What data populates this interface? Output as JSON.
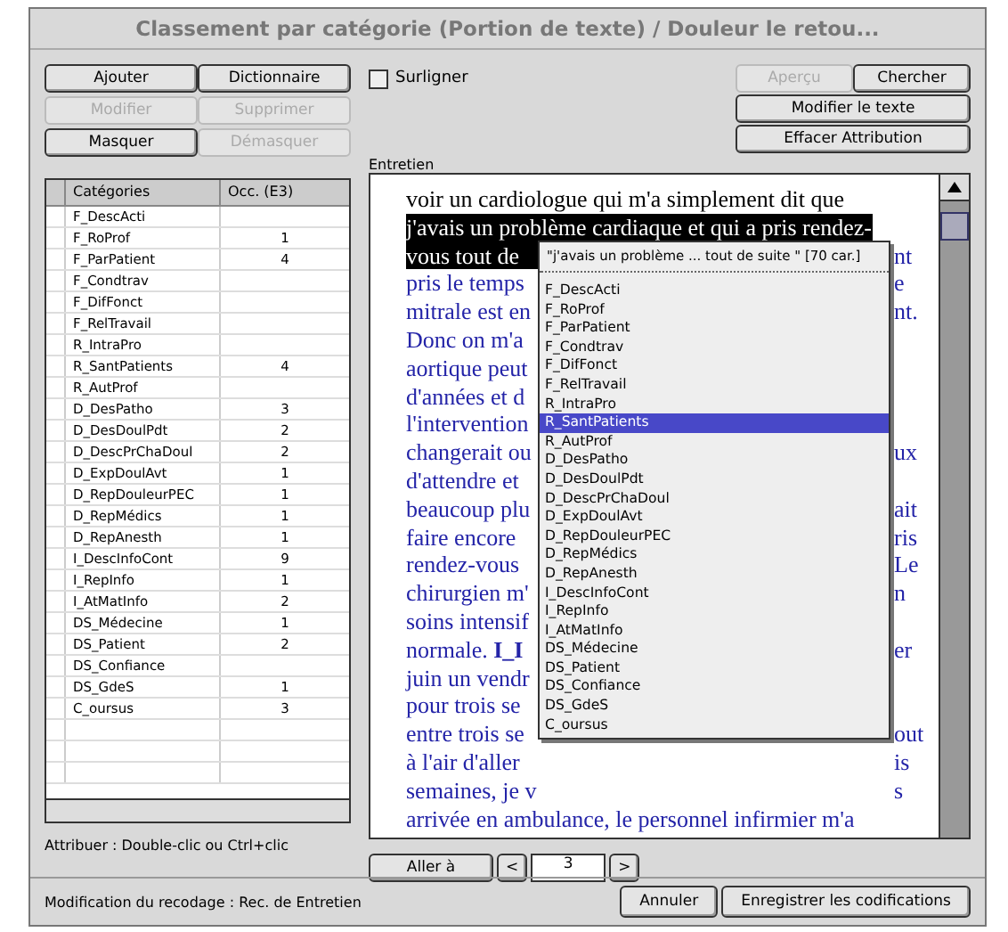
{
  "window": {
    "title": "Classement par catégorie (Portion de texte) / Douleur le retou..."
  },
  "left_buttons": [
    {
      "label": "Ajouter",
      "disabled": false
    },
    {
      "label": "Dictionnaire",
      "disabled": false
    },
    {
      "label": "Modifier",
      "disabled": true
    },
    {
      "label": "Supprimer",
      "disabled": true
    },
    {
      "label": "Masquer",
      "disabled": false
    },
    {
      "label": "Démasquer",
      "disabled": true
    }
  ],
  "highlight": {
    "label": "Surligner",
    "checked": false
  },
  "right_buttons": [
    {
      "label": "Aperçu",
      "disabled": true
    },
    {
      "label": "Chercher",
      "disabled": false
    },
    {
      "label": "Modifier le texte",
      "disabled": false
    },
    {
      "label": "Effacer Attribution",
      "disabled": false
    }
  ],
  "table": {
    "columns": [
      "Catégories",
      "Occ. (E3)"
    ],
    "rows": [
      [
        "F_DescActi",
        ""
      ],
      [
        "F_RoProf",
        "1"
      ],
      [
        "F_ParPatient",
        "4"
      ],
      [
        "F_Condtrav",
        ""
      ],
      [
        "F_DifFonct",
        ""
      ],
      [
        "F_RelTravail",
        ""
      ],
      [
        "R_IntraPro",
        ""
      ],
      [
        "R_SantPatients",
        "4"
      ],
      [
        "R_AutProf",
        ""
      ],
      [
        "D_DesPatho",
        "3"
      ],
      [
        "D_DesDoulPdt",
        "2"
      ],
      [
        "D_DescPrChaDoul",
        "2"
      ],
      [
        "D_ExpDoulAvt",
        "1"
      ],
      [
        "D_RepDouleurPEC",
        "1"
      ],
      [
        "D_RepMédics",
        "1"
      ],
      [
        "D_RepAnesth",
        "1"
      ],
      [
        "I_DescInfoCont",
        "9"
      ],
      [
        "I_RepInfo",
        "1"
      ],
      [
        "I_AtMatInfo",
        "2"
      ],
      [
        "DS_Médecine",
        "1"
      ],
      [
        "DS_Patient",
        "2"
      ],
      [
        "DS_Confiance",
        ""
      ],
      [
        "DS_GdeS",
        "1"
      ],
      [
        "C_oursus",
        "3"
      ]
    ]
  },
  "hint": "Attribuer : Double-clic ou Ctrl+clic",
  "text_label": "Entretien",
  "text_lines": [
    {
      "kind": "plain",
      "left": "voir un cardiologue qui m'a simplement dit que"
    },
    {
      "kind": "selected",
      "left": "j'avais un problème cardiaque et qui a pris rendez-"
    },
    {
      "kind": "selected",
      "left": "vous tout de",
      "right": "nt"
    },
    {
      "kind": "coded",
      "left": "pris le temps",
      "right": "e"
    },
    {
      "kind": "coded",
      "left": "mitrale est en",
      "right": "nt."
    },
    {
      "kind": "coded",
      "left": "Donc on m'a"
    },
    {
      "kind": "coded",
      "left": "aortique peut"
    },
    {
      "kind": "coded",
      "left": "d'années et d"
    },
    {
      "kind": "coded",
      "left": "l'intervention"
    },
    {
      "kind": "coded",
      "left": "changerait ou",
      "right": "ux"
    },
    {
      "kind": "coded",
      "left": "d'attendre et"
    },
    {
      "kind": "coded",
      "left": "beaucoup plu",
      "right": "ait"
    },
    {
      "kind": "coded",
      "left": "faire encore",
      "right": "ris"
    },
    {
      "kind": "coded",
      "left": "rendez-vous",
      "right": "Le"
    },
    {
      "kind": "coded",
      "left": "chirurgien m'",
      "right": "n"
    },
    {
      "kind": "coded",
      "left": "soins intensif"
    },
    {
      "kind": "coded",
      "left": "normale. **I_I**",
      "right": "er"
    },
    {
      "kind": "coded",
      "left": "juin un vendr"
    },
    {
      "kind": "coded",
      "left": "pour trois se"
    },
    {
      "kind": "coded",
      "left": "entre trois se",
      "right": "out"
    },
    {
      "kind": "coded",
      "left": "à l'air d'aller",
      "right": "is"
    },
    {
      "kind": "coded",
      "left": "semaines, je v",
      "right": "s"
    },
    {
      "kind": "coded",
      "left": "arrivée en ambulance, le personnel infirmier m'a"
    }
  ],
  "popup": {
    "header": "\"j'avais un problème ... tout de suite \" [70 car.]",
    "items": [
      {
        "label": "F_DescActi",
        "selected": false
      },
      {
        "label": "F_RoProf",
        "selected": false
      },
      {
        "label": "F_ParPatient",
        "selected": false
      },
      {
        "label": "F_Condtrav",
        "selected": false
      },
      {
        "label": "F_DifFonct",
        "selected": false
      },
      {
        "label": "F_RelTravail",
        "selected": false
      },
      {
        "label": "R_IntraPro",
        "selected": false
      },
      {
        "label": "R_SantPatients",
        "selected": true
      },
      {
        "label": "R_AutProf",
        "selected": false
      },
      {
        "label": "D_DesPatho",
        "selected": false
      },
      {
        "label": "D_DesDoulPdt",
        "selected": false
      },
      {
        "label": "D_DescPrChaDoul",
        "selected": false
      },
      {
        "label": "D_ExpDoulAvt",
        "selected": false
      },
      {
        "label": "D_RepDouleurPEC",
        "selected": false
      },
      {
        "label": "D_RepMédics",
        "selected": false
      },
      {
        "label": "D_RepAnesth",
        "selected": false
      },
      {
        "label": "I_DescInfoCont",
        "selected": false
      },
      {
        "label": "I_RepInfo",
        "selected": false
      },
      {
        "label": "I_AtMatInfo",
        "selected": false
      },
      {
        "label": "DS_Médecine",
        "selected": false
      },
      {
        "label": "DS_Patient",
        "selected": false
      },
      {
        "label": "DS_Confiance",
        "selected": false
      },
      {
        "label": "DS_GdeS",
        "selected": false
      },
      {
        "label": "C_oursus",
        "selected": false
      }
    ]
  },
  "nav": {
    "button": "Aller à",
    "prev": "<",
    "page": "3",
    "next": ">"
  },
  "status": "Modification du recodage : Rec. de Entretien",
  "footer_buttons": [
    "Annuler",
    "Enregistrer les codifications"
  ]
}
